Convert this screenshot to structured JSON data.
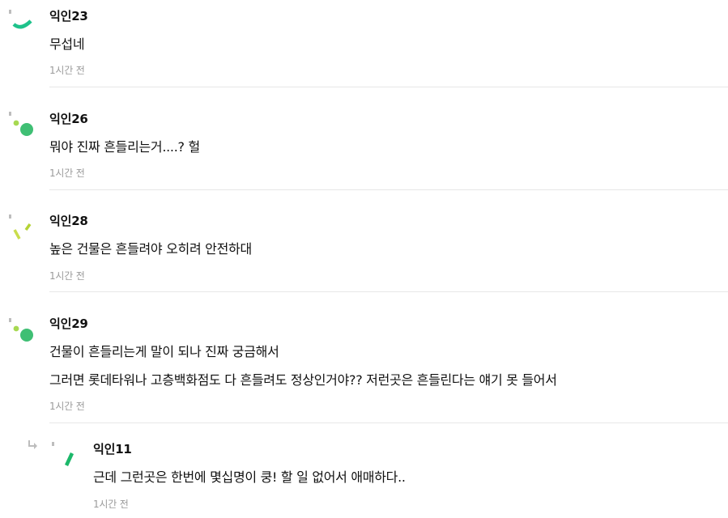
{
  "comments": [
    {
      "author": "익인23",
      "lines": [
        "무섭네"
      ],
      "time": "1시간 전",
      "avatar_icon": "teal-arc-icon",
      "avatar_color": "#1ec28b"
    },
    {
      "author": "익인26",
      "lines": [
        "뭐야 진짜 흔들리는거....? 헐"
      ],
      "time": "1시간 전",
      "avatar_icon": "green-dots-icon",
      "avatar_color": "#3fbf74"
    },
    {
      "author": "익인28",
      "lines": [
        "높은 건물은 흔들려야 오히려 안전하대"
      ],
      "time": "1시간 전",
      "avatar_icon": "lime-strokes-icon",
      "avatar_color": "#b5d334"
    },
    {
      "author": "익인29",
      "lines": [
        "건물이 흔들리는게 말이 되나 진짜 궁금해서",
        "그러면 롯데타워나 고층백화점도 다 흔들려도 정상인거야?? 저런곳은 흔들린다는 얘기 못 들어서"
      ],
      "time": "1시간 전",
      "avatar_icon": "green-dots-icon",
      "avatar_color": "#3fbf74"
    }
  ],
  "reply": {
    "author": "익인11",
    "lines": [
      "근데 그런곳은 한번에 몇십명이 쿵! 할 일 없어서 애매하다.."
    ],
    "time": "1시간 전",
    "avatar_icon": "green-stroke-icon",
    "avatar_color": "#1cb86a",
    "reply_icon": "reply-arrow-icon"
  }
}
